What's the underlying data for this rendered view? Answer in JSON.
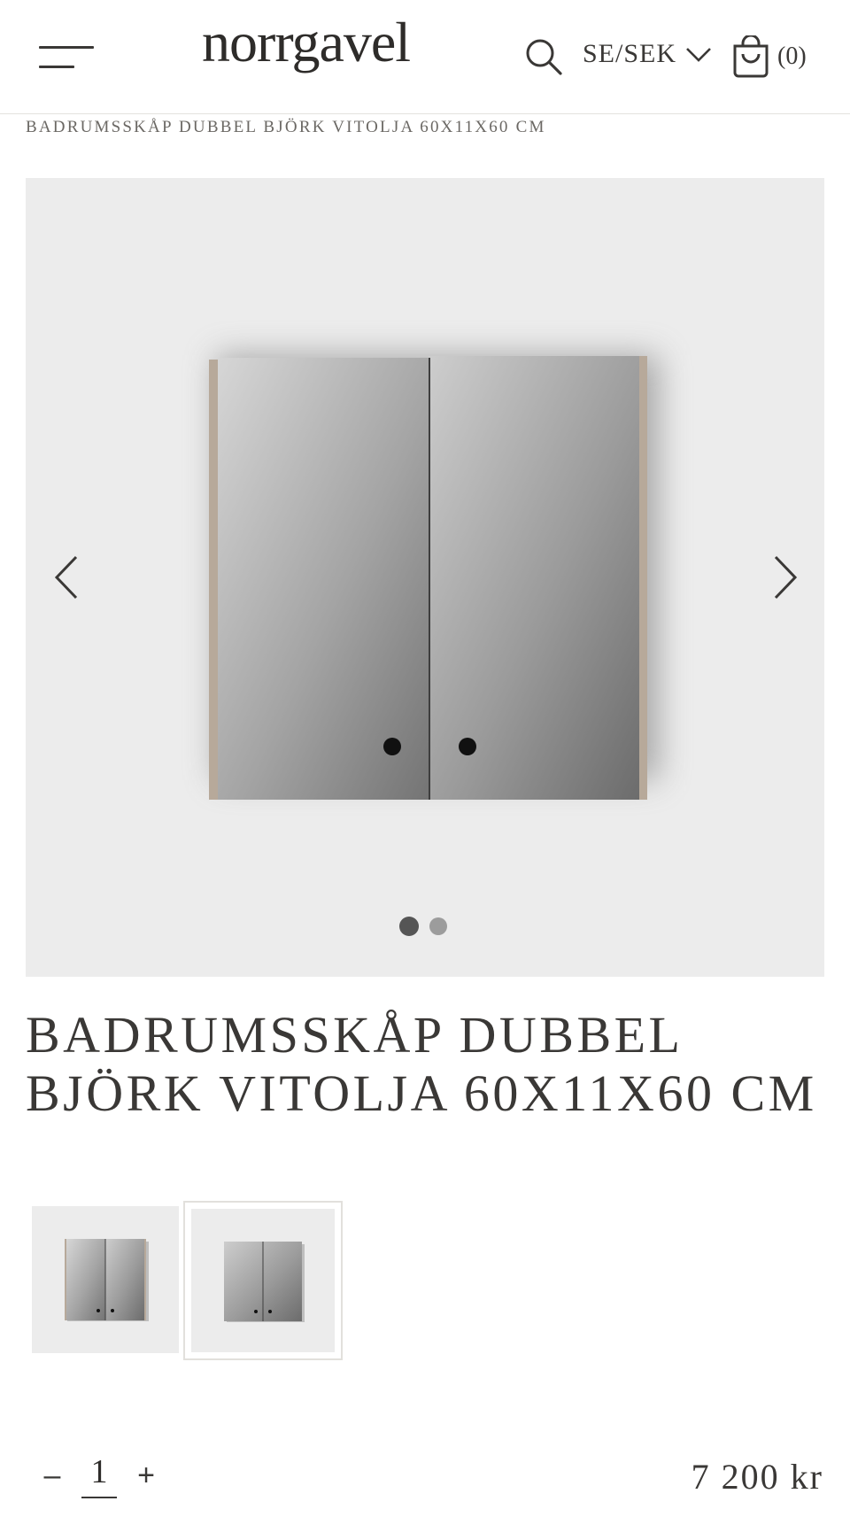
{
  "header": {
    "logo": "norrgavel",
    "locale": "SE/SEK",
    "cart_count": "(0)"
  },
  "breadcrumb": "BADRUMSSKÅP DUBBEL BJÖRK VITOLJA 60X11X60 CM",
  "gallery": {
    "slide_count": 2,
    "active_index": 0
  },
  "product": {
    "title_line1": "BADRUMSSKÅP DUBBEL",
    "title_line2": "BJÖRK VITOLJA 60X11X60 CM",
    "price": "7 200 kr",
    "quantity": "1",
    "qty_minus": "–",
    "qty_plus": "+"
  },
  "colors": {
    "text": "#3a3836",
    "image_bg": "#ececec",
    "mirror_light": "#c8c8c8",
    "mirror_dark": "#6e6e6e",
    "wood_edge": "#b7a99a"
  }
}
